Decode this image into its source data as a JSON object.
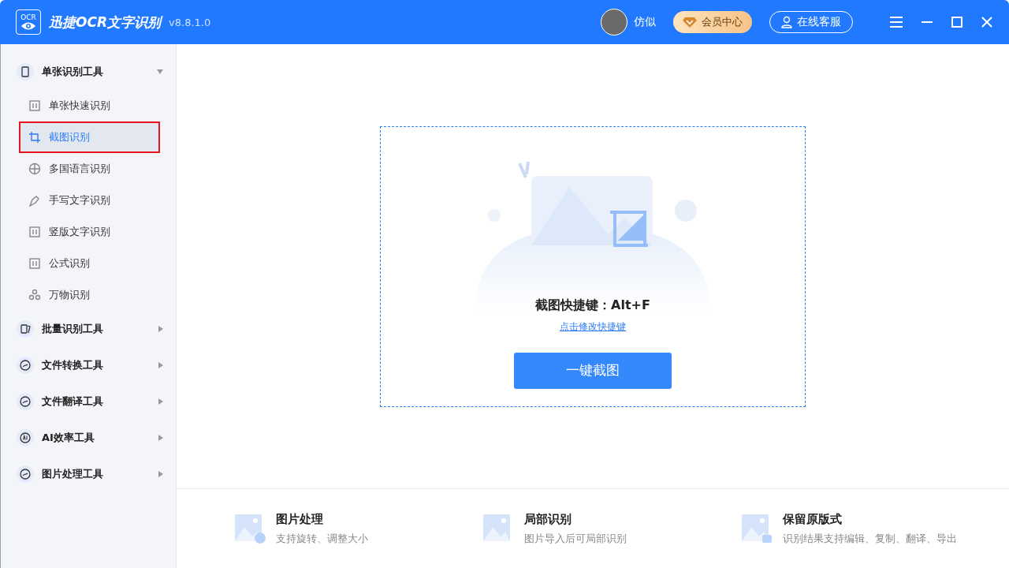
{
  "window": {
    "logo_text": "OCR",
    "title": "迅捷OCR文字识别",
    "version": "v8.8.1.0"
  },
  "header": {
    "user_name": "仿似",
    "vip_label": "会员中心",
    "service_label": "在线客服"
  },
  "sidebar": {
    "groups": [
      {
        "label": "单张识别工具",
        "expanded": true,
        "children": [
          {
            "label": "单张快速识别",
            "selected": false
          },
          {
            "label": "截图识别",
            "selected": true
          },
          {
            "label": "多国语言识别",
            "selected": false
          },
          {
            "label": "手写文字识别",
            "selected": false
          },
          {
            "label": "竖版文字识别",
            "selected": false
          },
          {
            "label": "公式识别",
            "selected": false
          },
          {
            "label": "万物识别",
            "selected": false
          }
        ]
      },
      {
        "label": "批量识别工具",
        "expanded": false
      },
      {
        "label": "文件转换工具",
        "expanded": false
      },
      {
        "label": "文件翻译工具",
        "expanded": false
      },
      {
        "label": "AI效率工具",
        "expanded": false
      },
      {
        "label": "图片处理工具",
        "expanded": false
      }
    ]
  },
  "capture": {
    "shortcut_text": "截图快捷键：Alt+F",
    "change_link": "点击修改快捷键",
    "button": "一键截图"
  },
  "features": [
    {
      "title": "图片处理",
      "description": "支持旋转、调整大小"
    },
    {
      "title": "局部识别",
      "description": "图片导入后可局部识别"
    },
    {
      "title": "保留原版式",
      "description": "识别结果支持编辑、复制、翻译、导出"
    }
  ]
}
